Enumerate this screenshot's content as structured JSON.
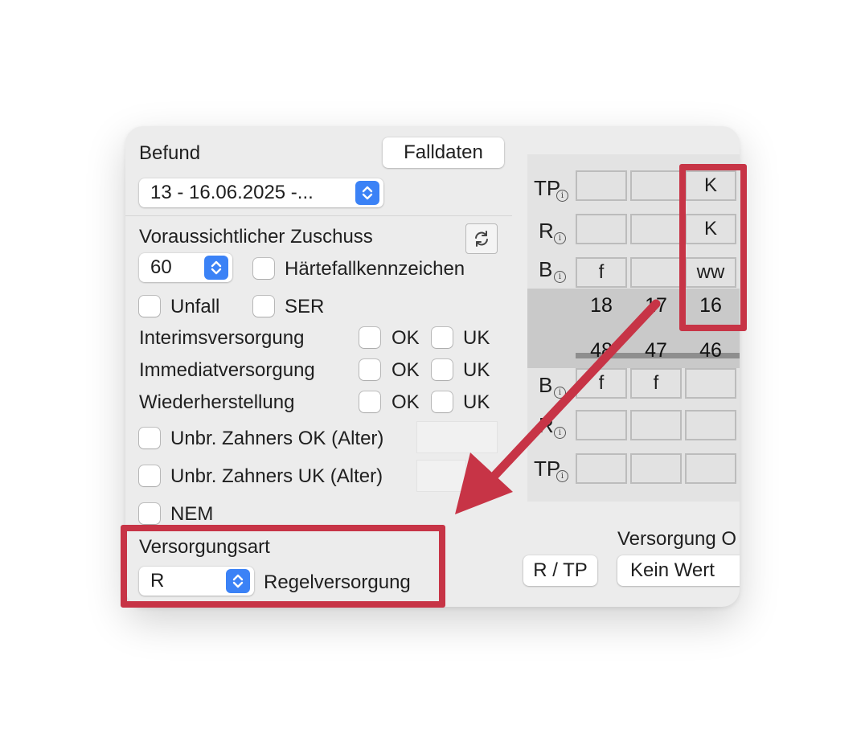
{
  "befund": {
    "label": "Befund",
    "falldaten_button": "Falldaten",
    "date_select": "13 - 16.06.2025 -..."
  },
  "zuschuss": {
    "label": "Voraussichtlicher Zuschuss",
    "value": "60",
    "haertefall_label": "Härtefallkennzeichen",
    "unfall_label": "Unfall",
    "ser_label": "SER"
  },
  "versorgungen": [
    {
      "label": "Interimsversorgung",
      "ok": "OK",
      "uk": "UK"
    },
    {
      "label": "Immediatversorgung",
      "ok": "OK",
      "uk": "UK"
    },
    {
      "label": "Wiederherstellung",
      "ok": "OK",
      "uk": "UK"
    }
  ],
  "unbr": {
    "ok_label": "Unbr. Zahners OK (Alter)",
    "uk_label": "Unbr. Zahners UK (Alter)",
    "nem_label": "NEM"
  },
  "versorgungsart": {
    "label": "Versorgungsart",
    "value": "R",
    "description": "Regelversorgung"
  },
  "right_bottom": {
    "rtp_button": "R / TP",
    "versorgung_label": "Versorgung O",
    "kein_wert": "Kein Wert"
  },
  "tooth_chart": {
    "upper_rows": [
      {
        "label": "TP",
        "cells": [
          "",
          "",
          "K"
        ]
      },
      {
        "label": "R",
        "cells": [
          "",
          "",
          "K"
        ]
      },
      {
        "label": "B",
        "cells": [
          "f",
          "",
          "ww"
        ]
      }
    ],
    "upper_teeth": [
      "18",
      "17",
      "16"
    ],
    "lower_teeth": [
      "48",
      "47",
      "46"
    ],
    "lower_rows": [
      {
        "label": "B",
        "cells": [
          "f",
          "f",
          ""
        ]
      },
      {
        "label": "R",
        "cells": [
          "",
          "",
          ""
        ]
      },
      {
        "label": "TP",
        "cells": [
          "",
          "",
          ""
        ]
      }
    ],
    "info_glyph": "i"
  },
  "colors": {
    "accent": "#3b82f6",
    "highlight": "#c73446",
    "panel": "#ececec"
  }
}
